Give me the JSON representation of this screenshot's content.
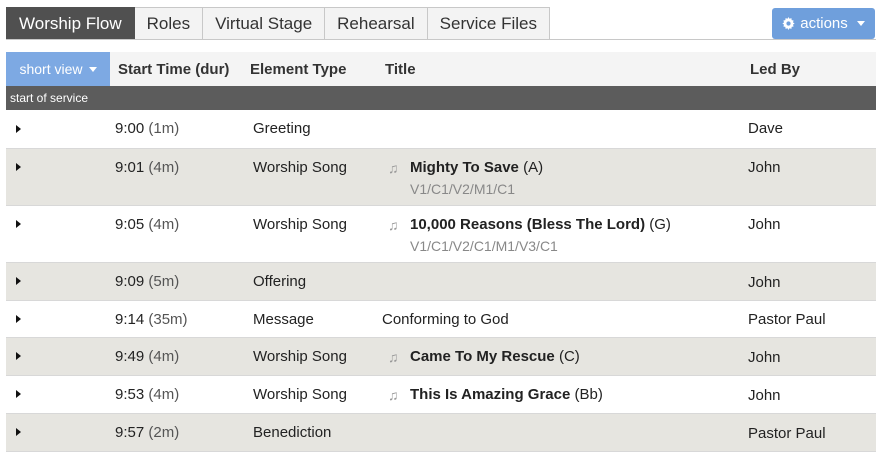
{
  "tabs": [
    {
      "label": "Worship Flow",
      "active": true
    },
    {
      "label": "Roles",
      "active": false
    },
    {
      "label": "Virtual Stage",
      "active": false
    },
    {
      "label": "Rehearsal",
      "active": false
    },
    {
      "label": "Service Files",
      "active": false
    }
  ],
  "actions_label": "actions",
  "table": {
    "view_label": "short view",
    "headers": {
      "start": "Start Time (dur)",
      "type": "Element Type",
      "title": "Title",
      "led_by": "Led By"
    },
    "section_label": "start of service",
    "rows": [
      {
        "time": "9:00",
        "dur": "(1m)",
        "type": "Greeting",
        "title": "",
        "key": "",
        "arrangement": "",
        "song": false,
        "led_by": "Dave"
      },
      {
        "time": "9:01",
        "dur": "(4m)",
        "type": "Worship Song",
        "title": "Mighty To Save",
        "key": "(A)",
        "arrangement": "V1/C1/V2/M1/C1",
        "song": true,
        "led_by": "John"
      },
      {
        "time": "9:05",
        "dur": "(4m)",
        "type": "Worship Song",
        "title": "10,000 Reasons (Bless The Lord)",
        "key": "(G)",
        "arrangement": "V1/C1/V2/C1/M1/V3/C1",
        "song": true,
        "led_by": "John"
      },
      {
        "time": "9:09",
        "dur": "(5m)",
        "type": "Offering",
        "title": "",
        "key": "",
        "arrangement": "",
        "song": false,
        "led_by": "John"
      },
      {
        "time": "9:14",
        "dur": "(35m)",
        "type": "Message",
        "title": "Conforming to God",
        "key": "",
        "arrangement": "",
        "song": false,
        "led_by": "Pastor Paul"
      },
      {
        "time": "9:49",
        "dur": "(4m)",
        "type": "Worship Song",
        "title": "Came To My Rescue",
        "key": "(C)",
        "arrangement": "",
        "song": true,
        "led_by": "John"
      },
      {
        "time": "9:53",
        "dur": "(4m)",
        "type": "Worship Song",
        "title": "This Is Amazing Grace",
        "key": "(Bb)",
        "arrangement": "",
        "song": true,
        "led_by": "John"
      },
      {
        "time": "9:57",
        "dur": "(2m)",
        "type": "Benediction",
        "title": "",
        "key": "",
        "arrangement": "",
        "song": false,
        "led_by": "Pastor Paul"
      }
    ]
  },
  "colors": {
    "active_tab": "#505050",
    "accent_blue": "#7da9e3",
    "actions_blue": "#6f9fdc",
    "section_bar": "#5c5c5c",
    "shaded_row": "#e6e5e0"
  },
  "icons": {
    "row_toggle": "caret-right-icon",
    "song": "music-note-icon",
    "actions": "gear-icon"
  }
}
